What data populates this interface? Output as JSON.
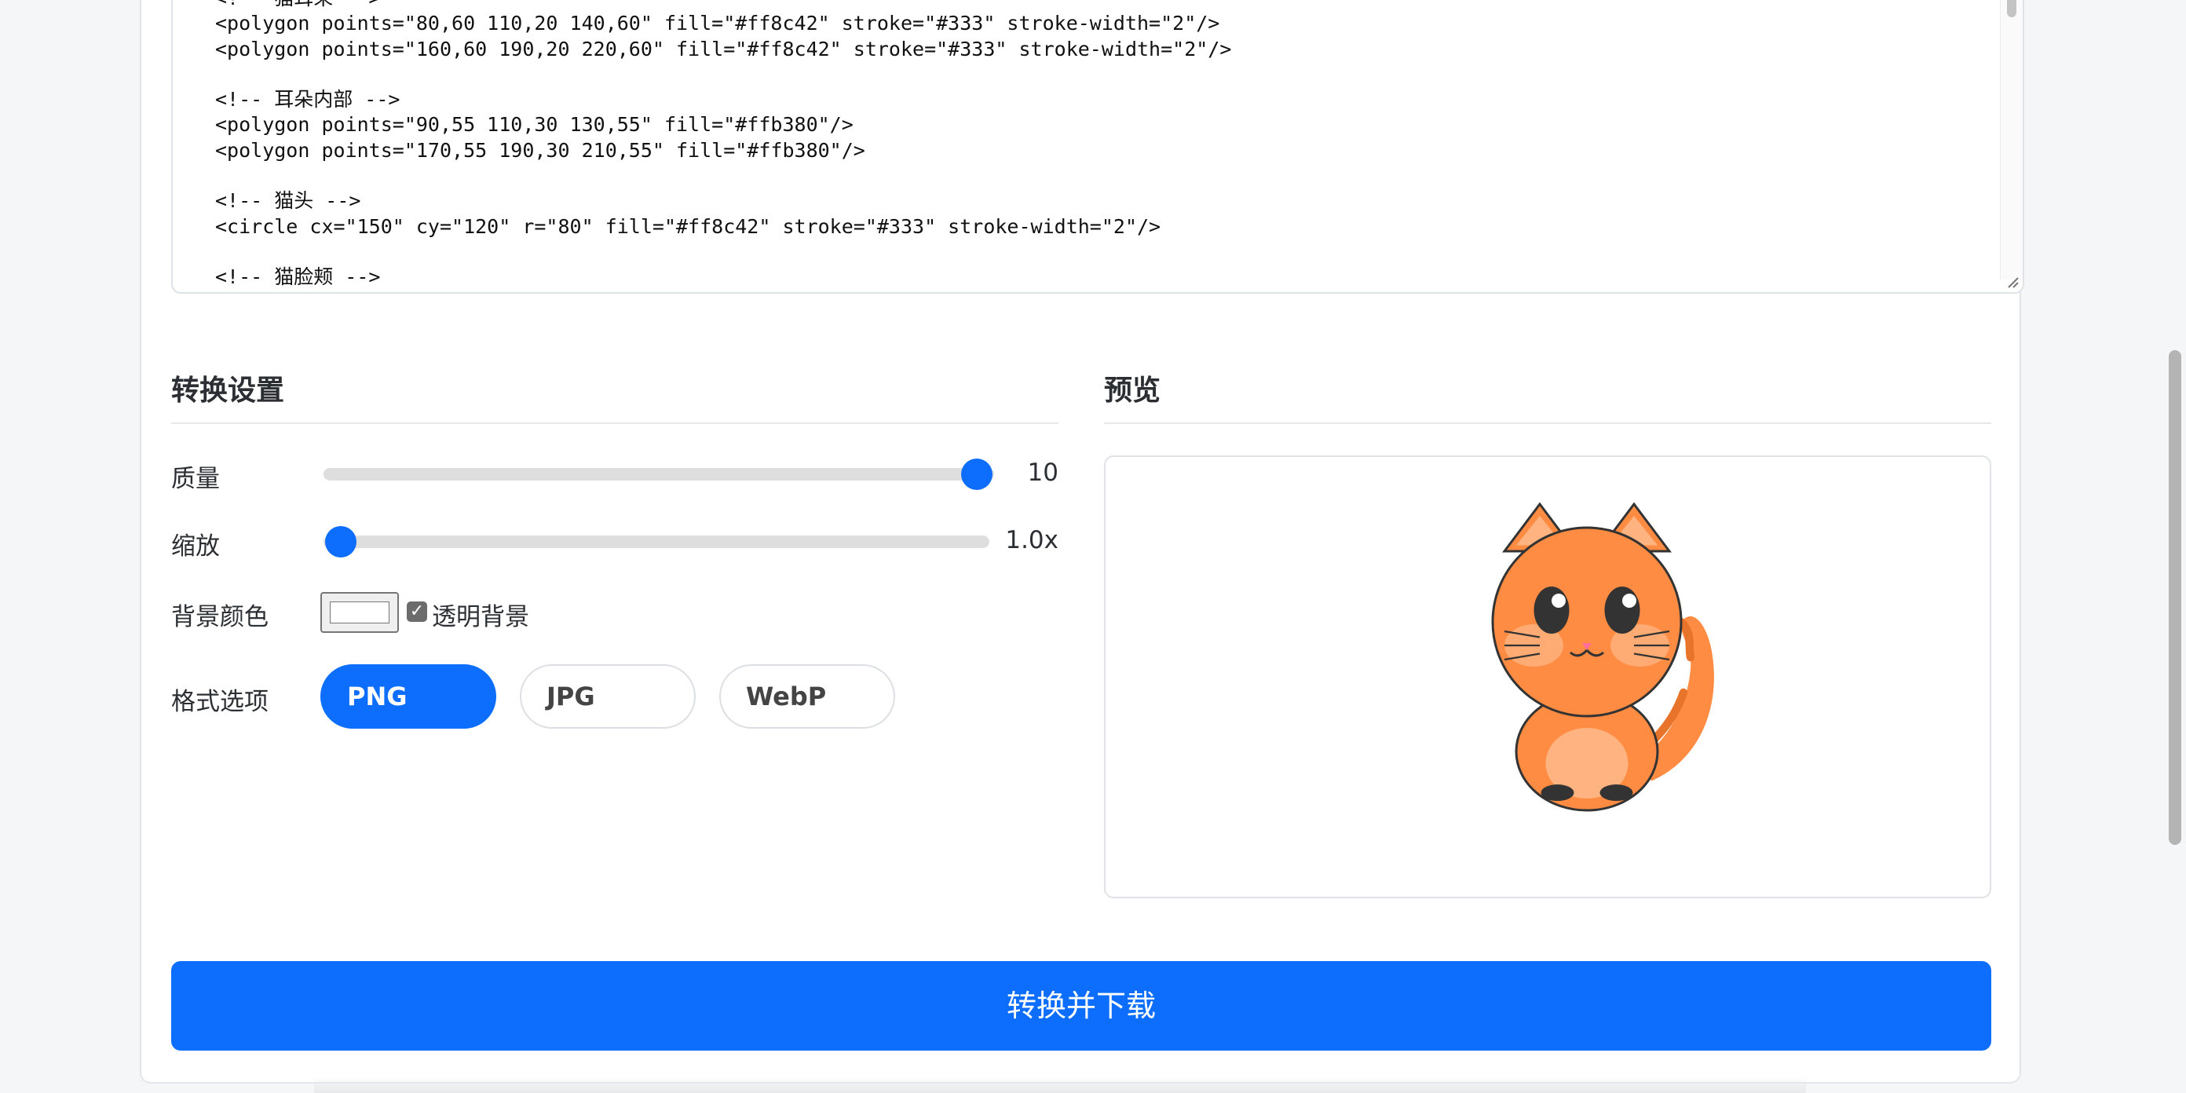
{
  "code": {
    "lines": [
      "<!-- 猫耳朵 -->",
      "<polygon points=\"80,60 110,20 140,60\" fill=\"#ff8c42\" stroke=\"#333\" stroke-width=\"2\"/>",
      "<polygon points=\"160,60 190,20 220,60\" fill=\"#ff8c42\" stroke=\"#333\" stroke-width=\"2\"/>",
      "",
      "<!-- 耳朵内部 -->",
      "<polygon points=\"90,55 110,30 130,55\" fill=\"#ffb380\"/>",
      "<polygon points=\"170,55 190,30 210,55\" fill=\"#ffb380\"/>",
      "",
      "<!-- 猫头 -->",
      "<circle cx=\"150\" cy=\"120\" r=\"80\" fill=\"#ff8c42\" stroke=\"#333\" stroke-width=\"2\"/>",
      "",
      "<!-- 猫脸颊 -->"
    ]
  },
  "settings": {
    "title": "转换设置",
    "quality": {
      "label": "质量",
      "value": 10,
      "min": 1,
      "max": 10,
      "display": "10"
    },
    "scale": {
      "label": "缩放",
      "value": 1.0,
      "min": 1.0,
      "max": 5.0,
      "display": "1.0x"
    },
    "background": {
      "label": "背景颜色",
      "color": "#ffffff",
      "transparent_label": "透明背景",
      "transparent_checked": true
    },
    "format": {
      "label": "格式选项",
      "options": [
        "PNG",
        "JPG",
        "WebP"
      ],
      "selected": "PNG"
    }
  },
  "preview": {
    "title": "预览"
  },
  "convert_button": {
    "label": "转换并下载"
  },
  "colors": {
    "accent": "#0d6efd",
    "cat_orange": "#ff8c42",
    "cat_light": "#ffb380",
    "outline": "#333333"
  }
}
